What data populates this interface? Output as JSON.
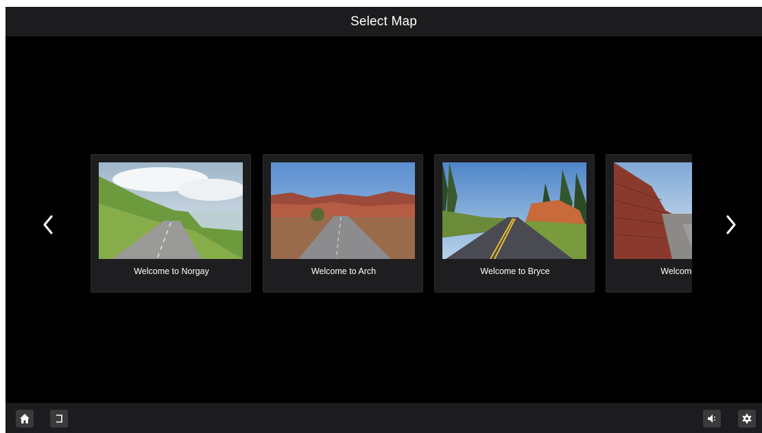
{
  "header": {
    "title": "Select Map"
  },
  "navigation": {
    "prev_icon": "chevron-left-icon",
    "next_icon": "chevron-right-icon"
  },
  "maps": [
    {
      "label": "Welcome to Norgay",
      "scene": "green hills, winding road, river, cloudy sky"
    },
    {
      "label": "Welcome to Arch",
      "scene": "red rock formations, desert road, blue sky"
    },
    {
      "label": "Welcome to Bryce",
      "scene": "pine forest, road with yellow center lines"
    },
    {
      "label": "Welcome to J",
      "scene": "ancient brick wall, stone walkway"
    }
  ],
  "footer": {
    "home_icon": "home-icon",
    "back_icon": "back-icon",
    "volume_icon": "volume-icon",
    "settings_icon": "gear-icon"
  },
  "colors": {
    "background": "#000000",
    "bar": "#1c1c1e",
    "card": "#1e1e20",
    "button": "#3a3a3c",
    "text": "#ffffff"
  }
}
